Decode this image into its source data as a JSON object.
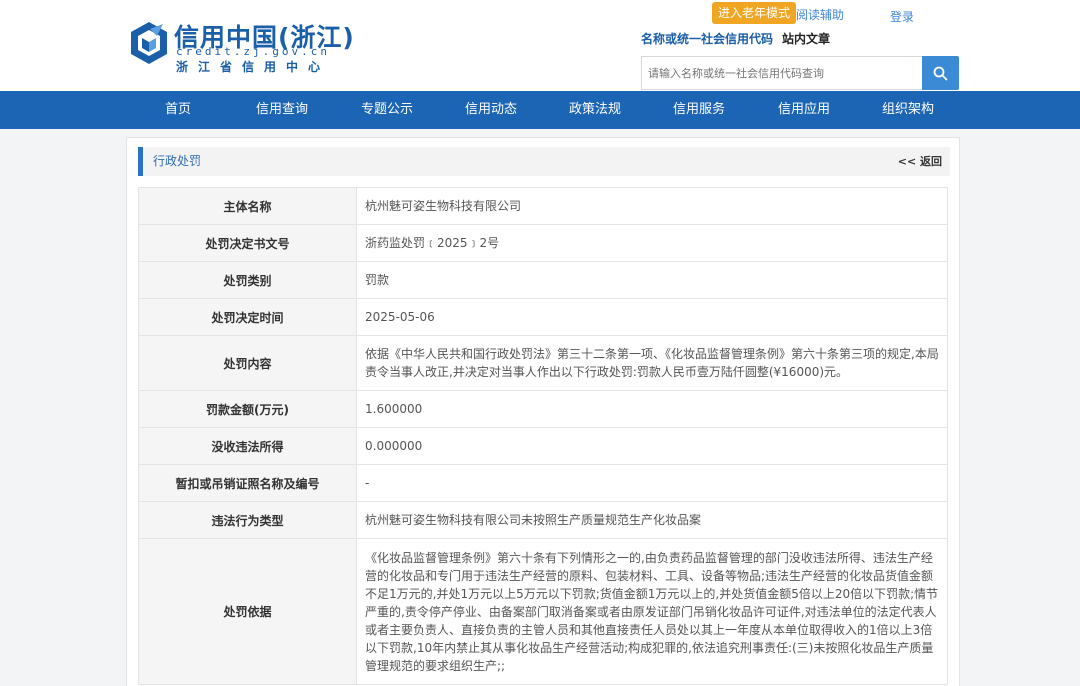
{
  "brand": {
    "title": "信用中国(浙江)",
    "domain": "credit.zj.gov.cn",
    "subtitle": "浙江省信用中心"
  },
  "top_links": {
    "elder_mode": "进入老年模式",
    "reading_aid": "阅读辅助",
    "login": "登录"
  },
  "search": {
    "tab_active": "名称或统一社会信用代码",
    "tab_other": "站内文章",
    "placeholder": "请输入名称或统一社会信用代码查询"
  },
  "nav": [
    "首页",
    "信用查询",
    "专题公示",
    "信用动态",
    "政策法规",
    "信用服务",
    "信用应用",
    "组织架构"
  ],
  "panel": {
    "title": "行政处罚",
    "back": "<< 返回"
  },
  "rows": [
    {
      "label": "主体名称",
      "value": "杭州魅可姿生物科技有限公司"
    },
    {
      "label": "处罚决定书文号",
      "value": "浙药监处罚﹝2025﹞2号"
    },
    {
      "label": "处罚类别",
      "value": "罚款"
    },
    {
      "label": "处罚决定时间",
      "value": "2025-05-06"
    },
    {
      "label": "处罚内容",
      "value": "依据《中华人民共和国行政处罚法》第三十二条第一项、《化妆品监督管理条例》第六十条第三项的规定,本局责令当事人改正,并决定对当事人作出以下行政处罚:罚款人民币壹万陆仟圆整(¥16000)元。"
    },
    {
      "label": "罚款金额(万元)",
      "value": "1.600000"
    },
    {
      "label": "没收违法所得",
      "value": "0.000000"
    },
    {
      "label": "暂扣或吊销证照名称及编号",
      "value": "-"
    },
    {
      "label": "违法行为类型",
      "value": "杭州魅可姿生物科技有限公司未按照生产质量规范生产化妆品案"
    },
    {
      "label": "处罚依据",
      "value": "《化妆品监督管理条例》第六十条有下列情形之一的,由负责药品监督管理的部门没收违法所得、违法生产经营的化妆品和专门用于违法生产经营的原料、包装材料、工具、设备等物品;违法生产经营的化妆品货值金额不足1万元的,并处1万元以上5万元以下罚款;货值金额1万元以上的,并处货值金额5倍以上20倍以下罚款;情节严重的,责令停产停业、由备案部门取消备案或者由原发证部门吊销化妆品许可证件,对违法单位的法定代表人或者主要负责人、直接负责的主管人员和其他直接责任人员处以其上一年度从本单位取得收入的1倍以上3倍以下罚款,10年内禁止其从事化妆品生产经营活动;构成犯罪的,依法追究刑事责任:(三)未按照化妆品生产质量管理规范的要求组织生产;;"
    }
  ]
}
